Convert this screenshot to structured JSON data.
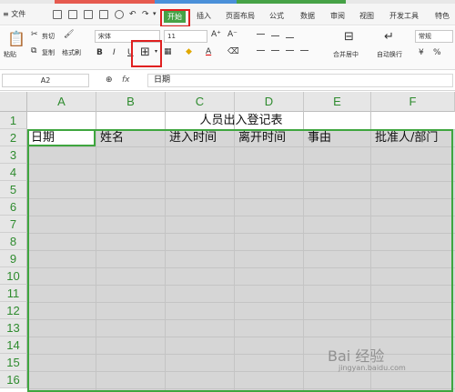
{
  "menubar": {
    "file": "≡ 文件",
    "tabs": [
      {
        "label": "插入"
      },
      {
        "label": "页面布局"
      },
      {
        "label": "公式"
      },
      {
        "label": "数据"
      },
      {
        "label": "审阅"
      },
      {
        "label": "视图"
      },
      {
        "label": "开发工具"
      },
      {
        "label": "特色"
      }
    ],
    "active_tab": "开始"
  },
  "ribbon": {
    "paste": "粘贴",
    "cut": "剪切",
    "copy": "复制",
    "format_painter": "格式刷",
    "font_name": "宋体",
    "font_size": "11",
    "grow": "A⁺",
    "shrink": "A⁻",
    "bold": "B",
    "italic": "I",
    "underline": "U",
    "merge": "合并居中",
    "wrap": "自动换行",
    "number_format": "常规"
  },
  "formula_bar": {
    "cell_ref": "A2",
    "fx": "fx",
    "value": "日期"
  },
  "sheet": {
    "columns": [
      "A",
      "B",
      "C",
      "D",
      "E",
      "F"
    ],
    "rows": [
      "1",
      "2",
      "3",
      "4",
      "5",
      "6",
      "7",
      "8",
      "9",
      "10",
      "11",
      "12",
      "13",
      "14",
      "15",
      "16"
    ],
    "title": "人员出入登记表",
    "headers": [
      "日期",
      "姓名",
      "进入时间",
      "离开时间",
      "事由",
      "批准人/部门"
    ]
  },
  "watermark": "Bai 经验",
  "watermark_sub": "jingyan.baidu.com",
  "colors": {
    "accent": "#46a246",
    "highlight": "#e02020",
    "selection": "#d6d6d6"
  }
}
